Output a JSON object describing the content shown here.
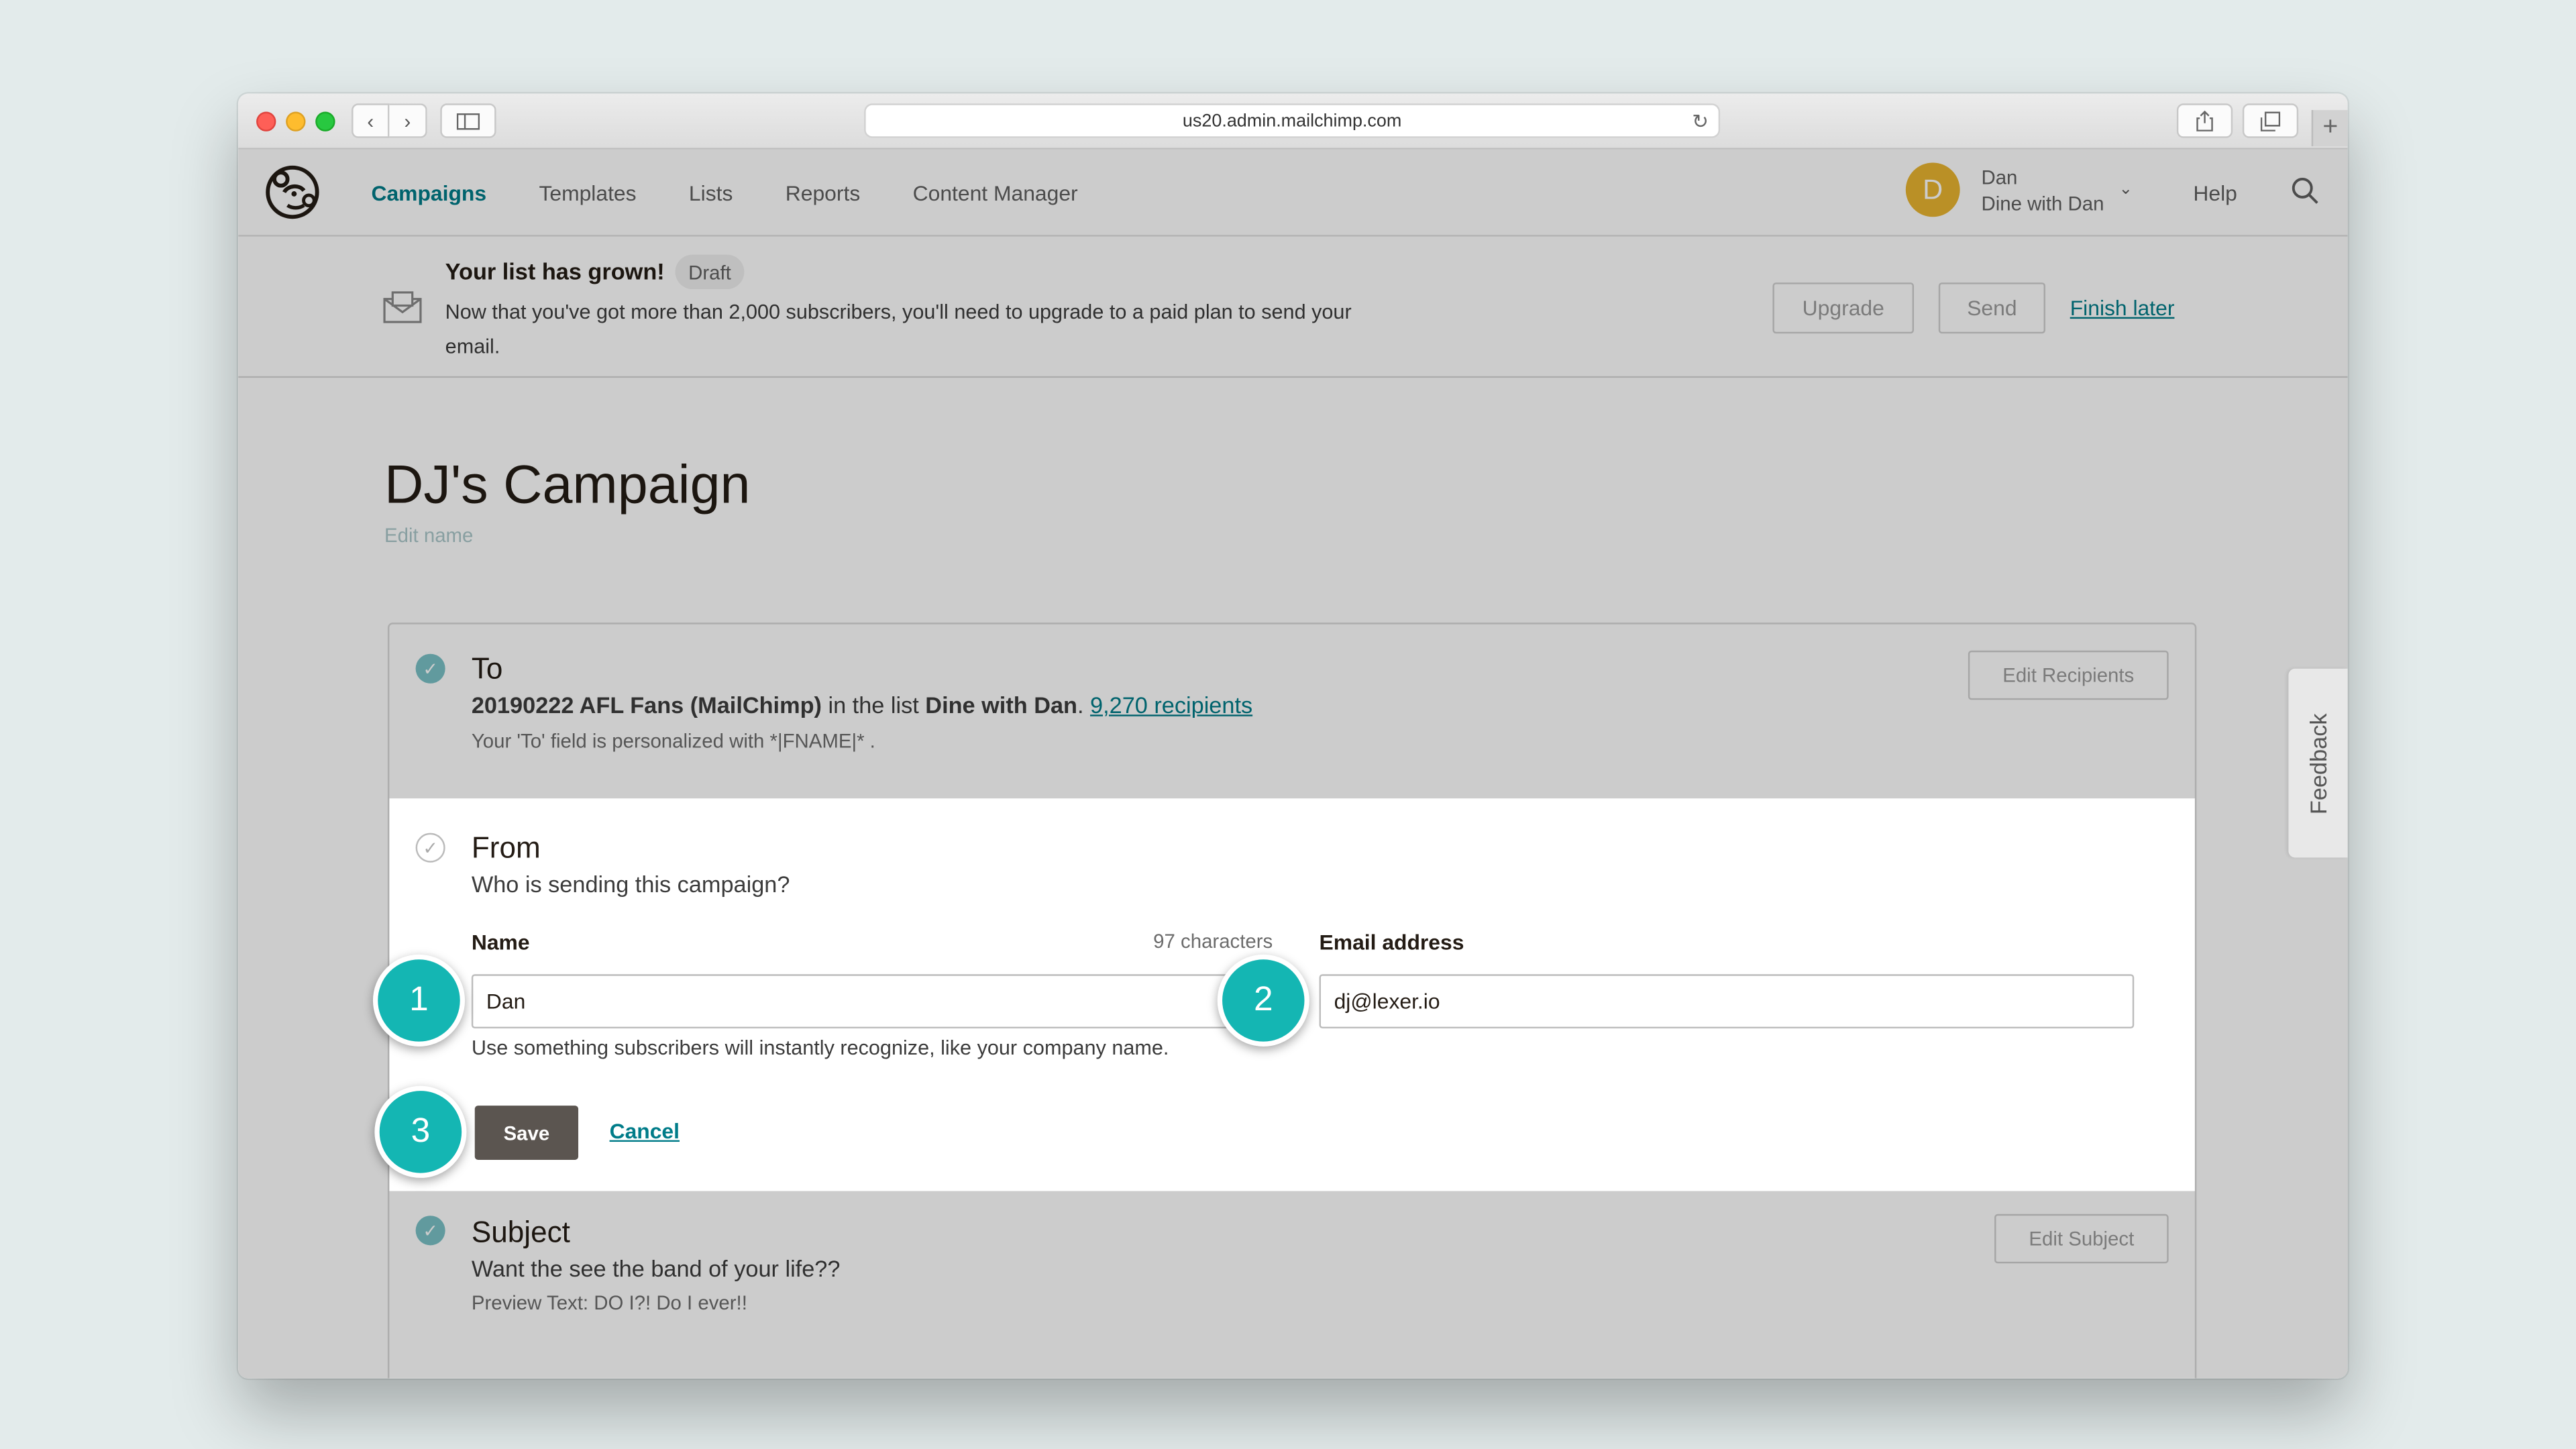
{
  "browser": {
    "url": "us20.admin.mailchimp.com"
  },
  "nav": {
    "items": [
      "Campaigns",
      "Templates",
      "Lists",
      "Reports",
      "Content Manager"
    ],
    "help": "Help"
  },
  "user": {
    "initial": "D",
    "name": "Dan",
    "account": "Dine with Dan"
  },
  "banner": {
    "title": "Your list has grown!",
    "badge": "Draft",
    "text": "Now that you've got more than 2,000 subscribers, you'll need to upgrade to a paid plan to send your email.",
    "upgrade": "Upgrade",
    "send": "Send",
    "finish_later": "Finish later"
  },
  "campaign": {
    "title": "DJ's Campaign",
    "edit_name": "Edit name"
  },
  "to": {
    "title": "To",
    "segment": "20190222 AFL Fans (MailChimp)",
    "in_list": " in the list ",
    "list_name": "Dine with Dan",
    "period": ". ",
    "recipients": "9,270 recipients",
    "personalized": "Your 'To' field is personalized with *|FNAME|* .",
    "edit": "Edit Recipients"
  },
  "from": {
    "title": "From",
    "subtitle": "Who is sending this campaign?",
    "name_label": "Name",
    "char_count": "97 characters",
    "name_value": "Dan",
    "name_hint": "Use something subscribers will instantly recognize, like your company name.",
    "email_label": "Email address",
    "email_value": "dj@lexer.io",
    "save": "Save",
    "cancel": "Cancel"
  },
  "subject": {
    "title": "Subject",
    "line": "Want the see the band of your life??",
    "preview": "Preview Text: DO I?! Do I ever!!",
    "edit": "Edit Subject"
  },
  "markers": [
    "1",
    "2",
    "3"
  ],
  "feedback": "Feedback",
  "colors": {
    "accent": "#007c89",
    "marker": "#14b6b3",
    "avatar": "#e9b530",
    "save_button": "#5b5550"
  }
}
